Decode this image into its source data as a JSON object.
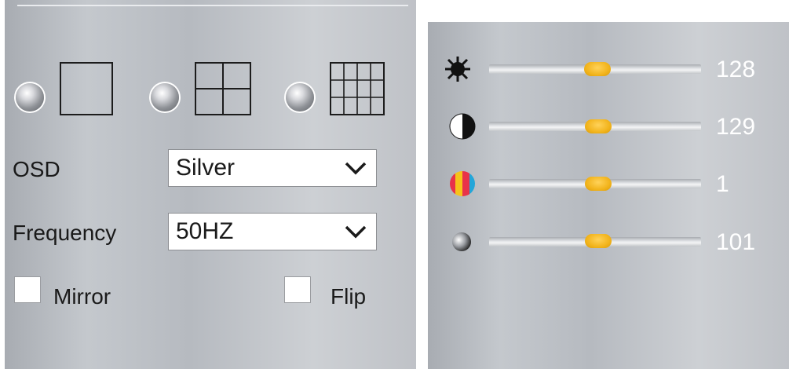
{
  "layout_options": [
    {
      "name": "single",
      "selected": false
    },
    {
      "name": "quad",
      "selected": false
    },
    {
      "name": "nine",
      "selected": false
    }
  ],
  "osd": {
    "label": "OSD",
    "value": "Silver"
  },
  "frequency": {
    "label": "Frequency",
    "value": "50HZ"
  },
  "mirror": {
    "label": "Mirror",
    "checked": false
  },
  "flip": {
    "label": "Flip",
    "checked": false
  },
  "sliders": [
    {
      "icon": "brightness-icon",
      "value": "128"
    },
    {
      "icon": "contrast-icon",
      "value": "129"
    },
    {
      "icon": "saturation-icon",
      "value": "1"
    },
    {
      "icon": "sharpness-icon",
      "value": "101"
    }
  ],
  "colors": {
    "thumb": "#f2b41c",
    "value_text": "#ffffff"
  }
}
